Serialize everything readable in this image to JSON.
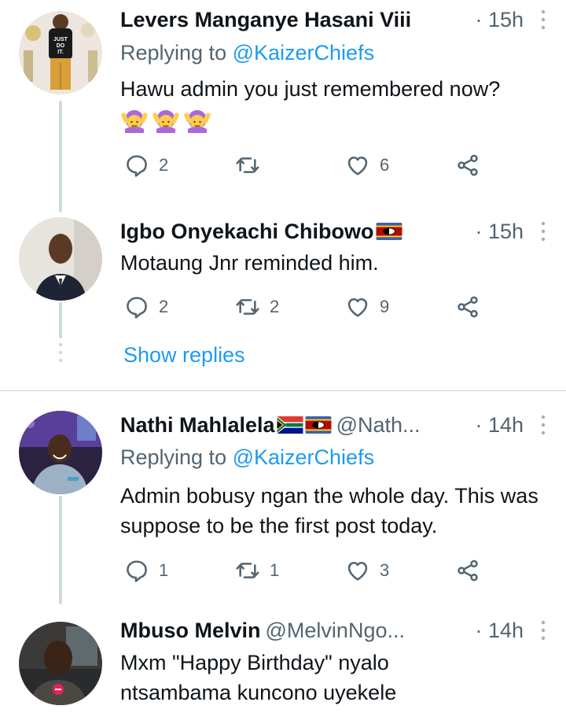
{
  "tweets": [
    {
      "name": "Levers Manganye Hasani Viii",
      "handle": "",
      "time": "· 15h",
      "replying_prefix": "Replying to ",
      "replying_to": "@KaizerChiefs",
      "text": "Hawu admin you just remembered now?",
      "emoji": [
        "woman-gesturing-no",
        "woman-gesturing-no",
        "woman-gesturing-no"
      ],
      "replies": "2",
      "retweets": "",
      "likes": "6"
    },
    {
      "name": "Igbo Onyekachi Chibowo",
      "handle": "",
      "time": "· 15h",
      "text": "Motaung Jnr reminded him.",
      "replies": "2",
      "retweets": "2",
      "likes": "9",
      "show_replies": "Show replies"
    },
    {
      "name": "Nathi Mahlalela",
      "handle": "@Nath...",
      "time": "· 14h",
      "replying_prefix": "Replying to ",
      "replying_to": "@KaizerChiefs",
      "text": "Admin bobusy ngan the whole day. This was suppose to be the first post today.",
      "replies": "1",
      "retweets": "1",
      "likes": "3"
    },
    {
      "name": "Mbuso Melvin",
      "handle": "@MelvinNgo...",
      "time": "· 14h",
      "text": "Mxm \"Happy Birthday\" nyalo ntsambama kuncono uyekele"
    }
  ],
  "colors": {
    "accent": "#1d9bf0",
    "secondary_text": "#536471",
    "primary_text": "#0f1419",
    "thread_line": "#cfd9de"
  },
  "icons": {
    "reply": "speech-bubble-icon",
    "retweet": "retweet-icon",
    "like": "heart-icon",
    "share": "share-icon",
    "more": "vertical-dots-icon",
    "flag_swaziland": "eswatini-flag-icon",
    "flag_south_africa": "south-africa-flag-icon"
  }
}
